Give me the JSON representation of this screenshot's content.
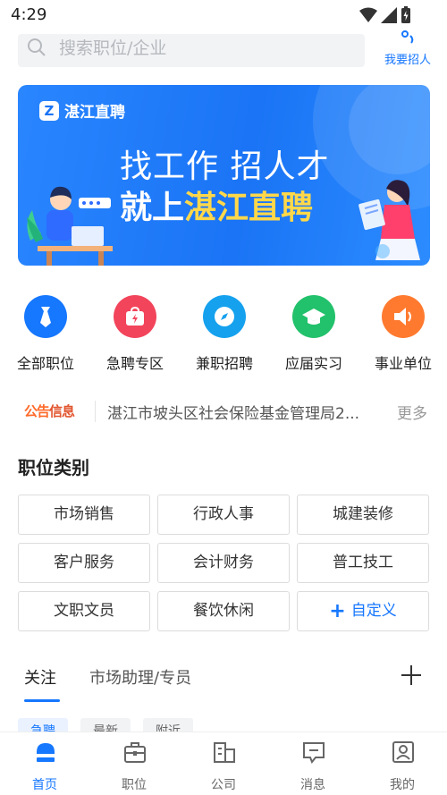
{
  "status_bar": {
    "time": "4:29"
  },
  "search": {
    "placeholder": "搜索职位/企业"
  },
  "recruit": {
    "label": "我要招人"
  },
  "banner": {
    "logo_text": "湛江直聘",
    "line1": "找工作 招人才",
    "line2_prefix": "就上",
    "line2_highlight": "湛江直聘"
  },
  "quick_entries": [
    {
      "label": "全部职位",
      "icon": "tie-icon",
      "color": "#1677ff"
    },
    {
      "label": "急聘专区",
      "icon": "bag-icon",
      "color": "#f2445b"
    },
    {
      "label": "兼职招聘",
      "icon": "compass-icon",
      "color": "#15a1ee"
    },
    {
      "label": "应届实习",
      "icon": "graduation-cap-icon",
      "color": "#22c16b"
    },
    {
      "label": "事业单位",
      "icon": "speaker-icon",
      "color": "#ff7a2f"
    }
  ],
  "notice": {
    "tag_part1": "公告",
    "tag_part2": "信息",
    "text": "湛江市坡头区社会保险基金管理局2...",
    "more": "更多"
  },
  "job_categories": {
    "title": "职位类别",
    "items": [
      "市场销售",
      "行政人事",
      "城建装修",
      "客户服务",
      "会计财务",
      "普工技工",
      "文职文员",
      "餐饮休闲"
    ],
    "custom_label": "自定义"
  },
  "tabs": {
    "active": "关注",
    "second": "市场助理/专员"
  },
  "filter_chips": [
    "急聘",
    "最新",
    "附近"
  ],
  "bottom_nav": [
    {
      "label": "首页",
      "active": true
    },
    {
      "label": "职位",
      "active": false
    },
    {
      "label": "公司",
      "active": false
    },
    {
      "label": "消息",
      "active": false
    },
    {
      "label": "我的",
      "active": false
    }
  ],
  "colors": {
    "accent": "#1677ff",
    "banner_highlight": "#ffd84a"
  }
}
